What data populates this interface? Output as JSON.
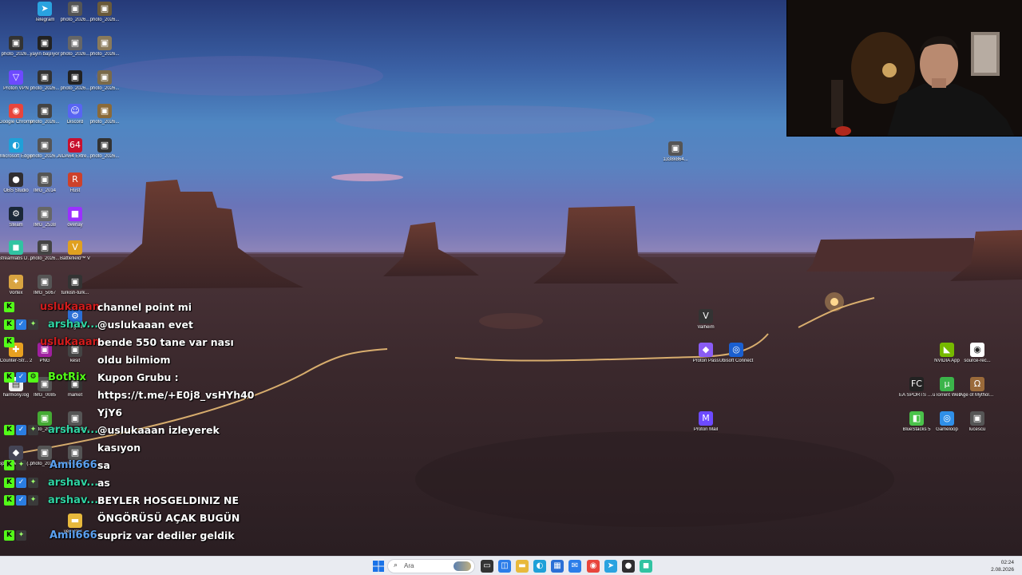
{
  "desktop": {
    "icons": [
      {
        "label": "Telegram",
        "icon": "telegram-icon",
        "color": "#2aa3e0"
      },
      {
        "label": "photo_2026...",
        "icon": "image-icon",
        "color": "#555"
      },
      {
        "label": "photo_2026...",
        "icon": "image-icon",
        "color": "#6a5a3a"
      },
      {
        "label": "photo_2026...",
        "icon": "image-icon",
        "color": "#333"
      },
      {
        "label": "yayın başlıyor",
        "icon": "image-icon",
        "color": "#222"
      },
      {
        "label": "photo_2026...",
        "icon": "image-icon",
        "color": "#666"
      },
      {
        "label": "photo_2026...",
        "icon": "image-icon",
        "color": "#8a7a5a"
      },
      {
        "label": "Proton VPN",
        "icon": "proton-vpn-icon",
        "color": "#6d4aff"
      },
      {
        "label": "photo_2026...",
        "icon": "image-icon",
        "color": "#333"
      },
      {
        "label": "photo_2026...",
        "icon": "image-icon",
        "color": "#222"
      },
      {
        "label": "photo_2026...",
        "icon": "image-icon",
        "color": "#7a6a4a"
      },
      {
        "label": "Google Chrome",
        "icon": "chrome-icon",
        "color": "#e8453c"
      },
      {
        "label": "photo_2026...",
        "icon": "image-icon",
        "color": "#444"
      },
      {
        "label": "Discord",
        "icon": "discord-icon",
        "color": "#5865f2"
      },
      {
        "label": "photo_2026...",
        "icon": "image-icon",
        "color": "#8a6a3a"
      },
      {
        "label": "Microsoft Edge",
        "icon": "edge-icon",
        "color": "#1fa0d8"
      },
      {
        "label": "photo_2026...",
        "icon": "image-icon",
        "color": "#555"
      },
      {
        "label": "AIDA64 Extreme",
        "icon": "aida64-icon",
        "color": "#c8102e"
      },
      {
        "label": "photo_2026...",
        "icon": "image-icon",
        "color": "#333"
      },
      {
        "label": "OBS Studio",
        "icon": "obs-icon",
        "color": "#302e31"
      },
      {
        "label": "IMG_2014",
        "icon": "image-icon",
        "color": "#555"
      },
      {
        "label": "Rust",
        "icon": "rust-icon",
        "color": "#cd412b"
      },
      {
        "label": "Steam",
        "icon": "steam-icon",
        "color": "#1b2838"
      },
      {
        "label": "IMG_2538",
        "icon": "image-icon",
        "color": "#666"
      },
      {
        "label": "overlay",
        "icon": "overlay-icon",
        "color": "#9b30ff"
      },
      {
        "label": "Streamlabs Desktop",
        "icon": "streamlabs-icon",
        "color": "#31c3a2"
      },
      {
        "label": "photo_2026...",
        "icon": "image-icon",
        "color": "#444"
      },
      {
        "label": "Battlefield™ V",
        "icon": "battlefield-icon",
        "color": "#e0a020"
      },
      {
        "label": "Vortex",
        "icon": "vortex-icon",
        "color": "#d9a441"
      },
      {
        "label": "IMG_5067",
        "icon": "image-icon",
        "color": "#555"
      },
      {
        "label": "turkish-turk...",
        "icon": "image-icon",
        "color": "#333"
      },
      {
        "label": "Engine",
        "icon": "engine-icon",
        "color": "#2b6fd6"
      },
      {
        "label": "Counter-Str... 2",
        "icon": "cs2-icon",
        "color": "#e8a020"
      },
      {
        "label": "PNG",
        "icon": "image-icon",
        "color": "#a020a0"
      },
      {
        "label": "kesit",
        "icon": "image-icon",
        "color": "#444"
      },
      {
        "label": "harmony.log",
        "icon": "file-icon",
        "color": "#eee"
      },
      {
        "label": "IMG_0085",
        "icon": "image-icon",
        "color": "#555"
      },
      {
        "label": "market",
        "icon": "image-icon",
        "color": "#333"
      },
      {
        "label": "Space M... 2 (15...",
        "icon": "game-icon",
        "color": "#445"
      },
      {
        "label": "photo_2026...",
        "icon": "image-icon",
        "color": "#555"
      },
      {
        "label": "photo_2026...",
        "icon": "image-icon",
        "color": "#4a3"
      },
      {
        "label": "photo_2026...",
        "icon": "image-icon",
        "color": "#555"
      },
      {
        "label": "photo_2026...",
        "icon": "image-icon",
        "color": "#555"
      },
      {
        "label": "yeni klas...",
        "icon": "folder-icon",
        "color": "#e8b93c"
      },
      {
        "label": "1338x864...",
        "icon": "image-icon",
        "color": "#555"
      },
      {
        "label": "Valheim",
        "icon": "valheim-icon",
        "color": "#333"
      },
      {
        "label": "Proton Pass",
        "icon": "proton-pass-icon",
        "color": "#8a5cf5"
      },
      {
        "label": "Ubisoft Connect",
        "icon": "ubisoft-icon",
        "color": "#1a5fd0"
      },
      {
        "label": "Proton Mail",
        "icon": "proton-mail-icon",
        "color": "#6d4aff"
      },
      {
        "label": "NVIDIA App",
        "icon": "nvidia-icon",
        "color": "#76b900"
      },
      {
        "label": "source-rec...",
        "icon": "record-icon",
        "color": "#fff"
      },
      {
        "label": "EA SPORTS FC™ 26",
        "icon": "ea-fc-icon",
        "color": "#222"
      },
      {
        "label": "uTorrent Web",
        "icon": "utorrent-icon",
        "color": "#3bb44a"
      },
      {
        "label": "Age of Mytholo...",
        "icon": "age-of-mythology-icon",
        "color": "#9a6a3a"
      },
      {
        "label": "BlueStacks 5",
        "icon": "bluestacks-icon",
        "color": "#4ac24a"
      },
      {
        "label": "Gameloop",
        "icon": "gameloop-icon",
        "color": "#2f8fe8"
      },
      {
        "label": "lucescu",
        "icon": "image-icon",
        "color": "#555"
      }
    ]
  },
  "chat": {
    "messages": [
      {
        "user": "uslukaaan",
        "user_color": "#d21c1c",
        "text": "channel point mi",
        "badges": [
          "kick-badge"
        ]
      },
      {
        "user": "arshav...",
        "user_color": "#2fd3a2",
        "text": "@uslukaaan evet",
        "badges": [
          "kick-badge",
          "verified-badge",
          "gift-badge"
        ]
      },
      {
        "user": "uslukaaan",
        "user_color": "#d21c1c",
        "text": "bende 550 tane var nası",
        "badges": [
          "kick-badge"
        ]
      },
      {
        "user": "",
        "user_color": "#ffffff",
        "text": "oldu bilmiom",
        "badges": []
      },
      {
        "user": "BotRix",
        "user_color": "#53fc18",
        "text": "Kupon Grubu :",
        "badges": [
          "kick-badge",
          "verified-badge",
          "bot-badge"
        ]
      },
      {
        "user": "",
        "user_color": "#ffffff",
        "text": "https://t.me/+E0j8_vsHYh40",
        "badges": []
      },
      {
        "user": "",
        "user_color": "#ffffff",
        "text": "YjY6",
        "badges": []
      },
      {
        "user": "arshav...",
        "user_color": "#2fd3a2",
        "text": "@uslukaaan izleyerek",
        "badges": [
          "kick-badge",
          "verified-badge",
          "gift-badge"
        ]
      },
      {
        "user": "",
        "user_color": "#ffffff",
        "text": "kasıyon",
        "badges": []
      },
      {
        "user": "Amil666",
        "user_color": "#5aa0f0",
        "text": "sa",
        "badges": [
          "kick-badge",
          "gift-badge"
        ]
      },
      {
        "user": "arshav...",
        "user_color": "#2fd3a2",
        "text": "as",
        "badges": [
          "kick-badge",
          "verified-badge",
          "gift-badge"
        ]
      },
      {
        "user": "arshav...",
        "user_color": "#2fd3a2",
        "text": "BEYLER HOSGELDINIZ NE",
        "badges": [
          "kick-badge",
          "verified-badge",
          "gift-badge"
        ]
      },
      {
        "user": "",
        "user_color": "#ffffff",
        "text": "ÖNGÖRÜSÜ AÇAK BUGÜN",
        "badges": []
      },
      {
        "user": "Amil666",
        "user_color": "#5aa0f0",
        "text": "supriz var dediler geldik",
        "badges": [
          "kick-badge",
          "gift-badge"
        ]
      }
    ]
  },
  "taskbar": {
    "search_placeholder": "Ara",
    "items": [
      {
        "icon": "start-icon",
        "color": "#1a73e8"
      },
      {
        "icon": "task-view-icon",
        "color": "#333"
      },
      {
        "icon": "widgets-icon",
        "color": "#2b7de9"
      },
      {
        "icon": "file-explorer-icon",
        "color": "#e8b93c"
      },
      {
        "icon": "edge-icon",
        "color": "#1fa0d8"
      },
      {
        "icon": "store-icon",
        "color": "#2b6fd6"
      },
      {
        "icon": "mail-icon",
        "color": "#2b7de9"
      },
      {
        "icon": "chrome-icon",
        "color": "#e8453c"
      },
      {
        "icon": "telegram-icon",
        "color": "#2aa3e0"
      },
      {
        "icon": "obs-icon",
        "color": "#302e31"
      },
      {
        "icon": "streamlabs-icon",
        "color": "#31c3a2"
      }
    ],
    "clock_time": "02:24",
    "clock_date": "2.08.2026"
  }
}
